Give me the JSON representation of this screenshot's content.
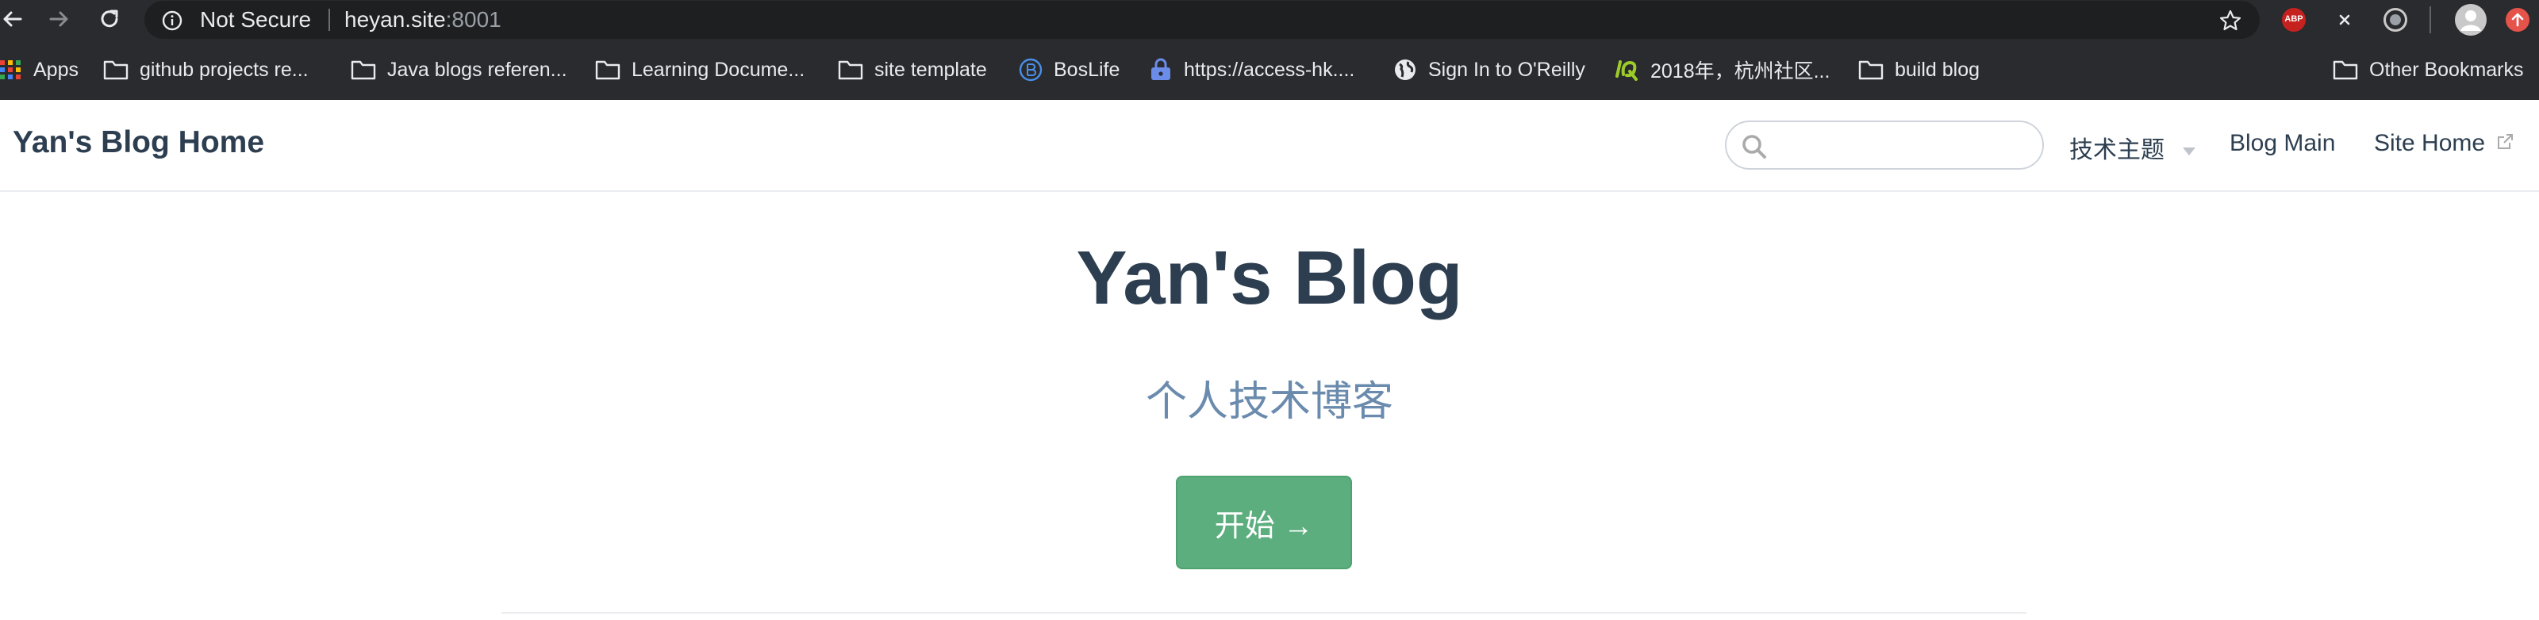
{
  "browser": {
    "security_label": "Not Secure",
    "url_host": "heyan.site",
    "url_port": ":8001",
    "extensions": {
      "abp_label": "ABP"
    }
  },
  "bookmarks": [
    {
      "label": "Apps",
      "icon": "apps-grid-icon"
    },
    {
      "label": "github projects re...",
      "icon": "folder-icon"
    },
    {
      "label": "Java blogs referen...",
      "icon": "folder-icon"
    },
    {
      "label": "Learning Docume...",
      "icon": "folder-icon"
    },
    {
      "label": "site template",
      "icon": "folder-icon"
    },
    {
      "label": "BosLife",
      "icon": "boslife-icon"
    },
    {
      "label": "https://access-hk....",
      "icon": "lock-icon"
    },
    {
      "label": "Sign In to O'Reilly",
      "icon": "globe-icon"
    },
    {
      "label": "2018年，杭州社区...",
      "icon": "iq-icon"
    },
    {
      "label": "build blog",
      "icon": "folder-icon"
    },
    {
      "label": "Other Bookmarks",
      "icon": "folder-icon"
    }
  ],
  "page": {
    "site_title": "Yan's Blog Home",
    "search": {
      "value": "",
      "placeholder": ""
    },
    "nav": {
      "topics": "技术主题",
      "blog_main": "Blog Main",
      "site_home": "Site Home"
    },
    "hero": {
      "title": "Yan's Blog",
      "subtitle": "个人技术博客",
      "action": "开始 →"
    }
  },
  "colors": {
    "accent": "#5cae7f",
    "text": "#2c3e50",
    "subtitle": "#6a8bad",
    "chrome_bg": "#2a2b2e"
  }
}
